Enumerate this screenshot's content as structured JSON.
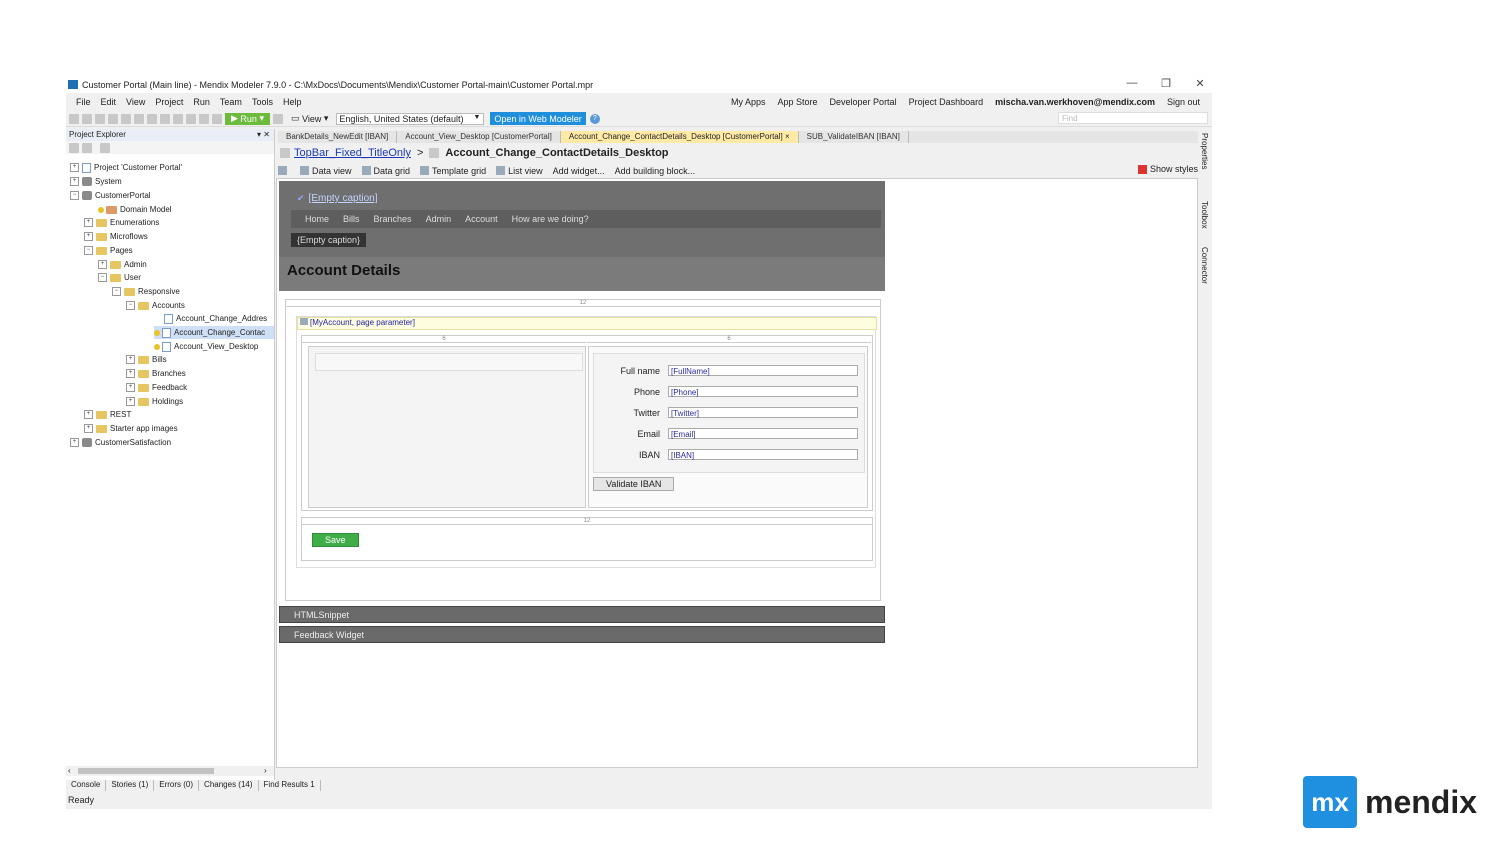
{
  "window": {
    "title": "Customer Portal (Main line) - Mendix Modeler 7.9.0 - C:\\MxDocs\\Documents\\Mendix\\Customer Portal-main\\Customer Portal.mpr",
    "minimize": "—",
    "restore": "❐",
    "close": "✕"
  },
  "menu": {
    "items": [
      "File",
      "Edit",
      "View",
      "Project",
      "Run",
      "Team",
      "Tools",
      "Help"
    ],
    "right": [
      "My Apps",
      "App Store",
      "Developer Portal",
      "Project Dashboard"
    ],
    "user": "mischa.van.werkhoven@mendix.com",
    "sign_out": "Sign out"
  },
  "toolbar": {
    "run_label": "Run",
    "view_label": "View",
    "language": "English, United States (default)",
    "web_modeler": "Open in Web Modeler",
    "search_placeholder": "Find"
  },
  "explorer": {
    "title": "Project Explorer",
    "header_controls": "▾ ✕",
    "tree": [
      "Project 'Customer Portal'",
      "System",
      "CustomerPortal",
      "Domain Model",
      "Enumerations",
      "Microflows",
      "Pages",
      "Admin",
      "User",
      "Responsive",
      "Accounts",
      "Account_Change_Addres",
      "Account_Change_Contac",
      "Account_View_Desktop",
      "Bills",
      "Branches",
      "Feedback",
      "Holdings",
      "REST",
      "Starter app images",
      "CustomerSatisfaction"
    ]
  },
  "bottom_tabs": [
    "Console",
    "Stories (1)",
    "Errors (0)",
    "Changes (14)",
    "Find Results 1"
  ],
  "status": "Ready",
  "doc_tabs": [
    "BankDetails_NewEdit [IBAN]",
    "Account_View_Desktop [CustomerPortal]",
    "Account_Change_ContactDetails_Desktop [CustomerPortal] ×",
    "SUB_ValidateIBAN [IBAN]"
  ],
  "breadcrumb": {
    "link": "TopBar_Fixed_TitleOnly",
    "sep": ">",
    "current": "Account_Change_ContactDetails_Desktop"
  },
  "page_tools": {
    "items": [
      "Data view",
      "Data grid",
      "Template grid",
      "List view",
      "Add widget...",
      "Add building block..."
    ],
    "show_styles": "Show styles"
  },
  "side_panels": [
    "Properties",
    "Toolbox",
    "Connector"
  ],
  "page": {
    "top_caption": "[Empty caption]",
    "nav": [
      "Home",
      "Bills",
      "Branches",
      "Admin",
      "Account",
      "How are we doing?"
    ],
    "empty_button": "{Empty caption}",
    "heading": "Account Details",
    "grid_12": "12",
    "grid_6a": "6",
    "grid_6b": "6",
    "dataview": "[MyAccount, page parameter]",
    "fields": [
      {
        "label": "Full name",
        "value": "[FullName]"
      },
      {
        "label": "Phone",
        "value": "[Phone]"
      },
      {
        "label": "Twitter",
        "value": "[Twitter]"
      },
      {
        "label": "Email",
        "value": "[Email]"
      },
      {
        "label": "IBAN",
        "value": "[IBAN]"
      }
    ],
    "validate_button": "Validate IBAN",
    "save_button": "Save",
    "snippets": [
      "HTMLSnippet",
      "Feedback Widget"
    ]
  },
  "logo": {
    "mark": "mx",
    "word": "mendix"
  }
}
